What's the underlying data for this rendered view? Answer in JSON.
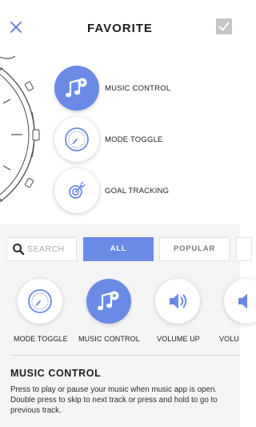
{
  "header": {
    "title": "FAVORITE",
    "close_icon": "close-x-icon",
    "confirm_icon": "checkmark-icon"
  },
  "colors": {
    "accent": "#6b8ae6",
    "sheet_background": "#f5f5f5",
    "confirm_disabled": "#c6c6c6"
  },
  "watch_slots": [
    {
      "label": "MUSIC CONTROL",
      "icon": "music-note-play-icon",
      "selected": true
    },
    {
      "label": "MODE TOGGLE",
      "icon": "dial-gauge-icon",
      "selected": false
    },
    {
      "label": "GOAL TRACKING",
      "icon": "target-arrow-icon",
      "selected": false
    }
  ],
  "search": {
    "placeholder": "SEARCH",
    "value": "",
    "icon": "search-icon"
  },
  "filters": [
    {
      "label": "ALL",
      "selected": true
    },
    {
      "label": "POPULAR",
      "selected": false
    }
  ],
  "functions": [
    {
      "label": "MODE TOGGLE",
      "icon": "dial-gauge-icon",
      "selected": false
    },
    {
      "label": "MUSIC CONTROL",
      "icon": "music-note-play-icon",
      "selected": true
    },
    {
      "label": "VOLUME UP",
      "icon": "speaker-volume-icon",
      "selected": false
    },
    {
      "label": "VOLU",
      "icon": "speaker-volume-icon",
      "selected": false
    }
  ],
  "detail": {
    "title": "MUSIC CONTROL",
    "description": "Press to play or pause your music when music app is open. Double press to skip to next track or press and hold to go to previous track."
  }
}
